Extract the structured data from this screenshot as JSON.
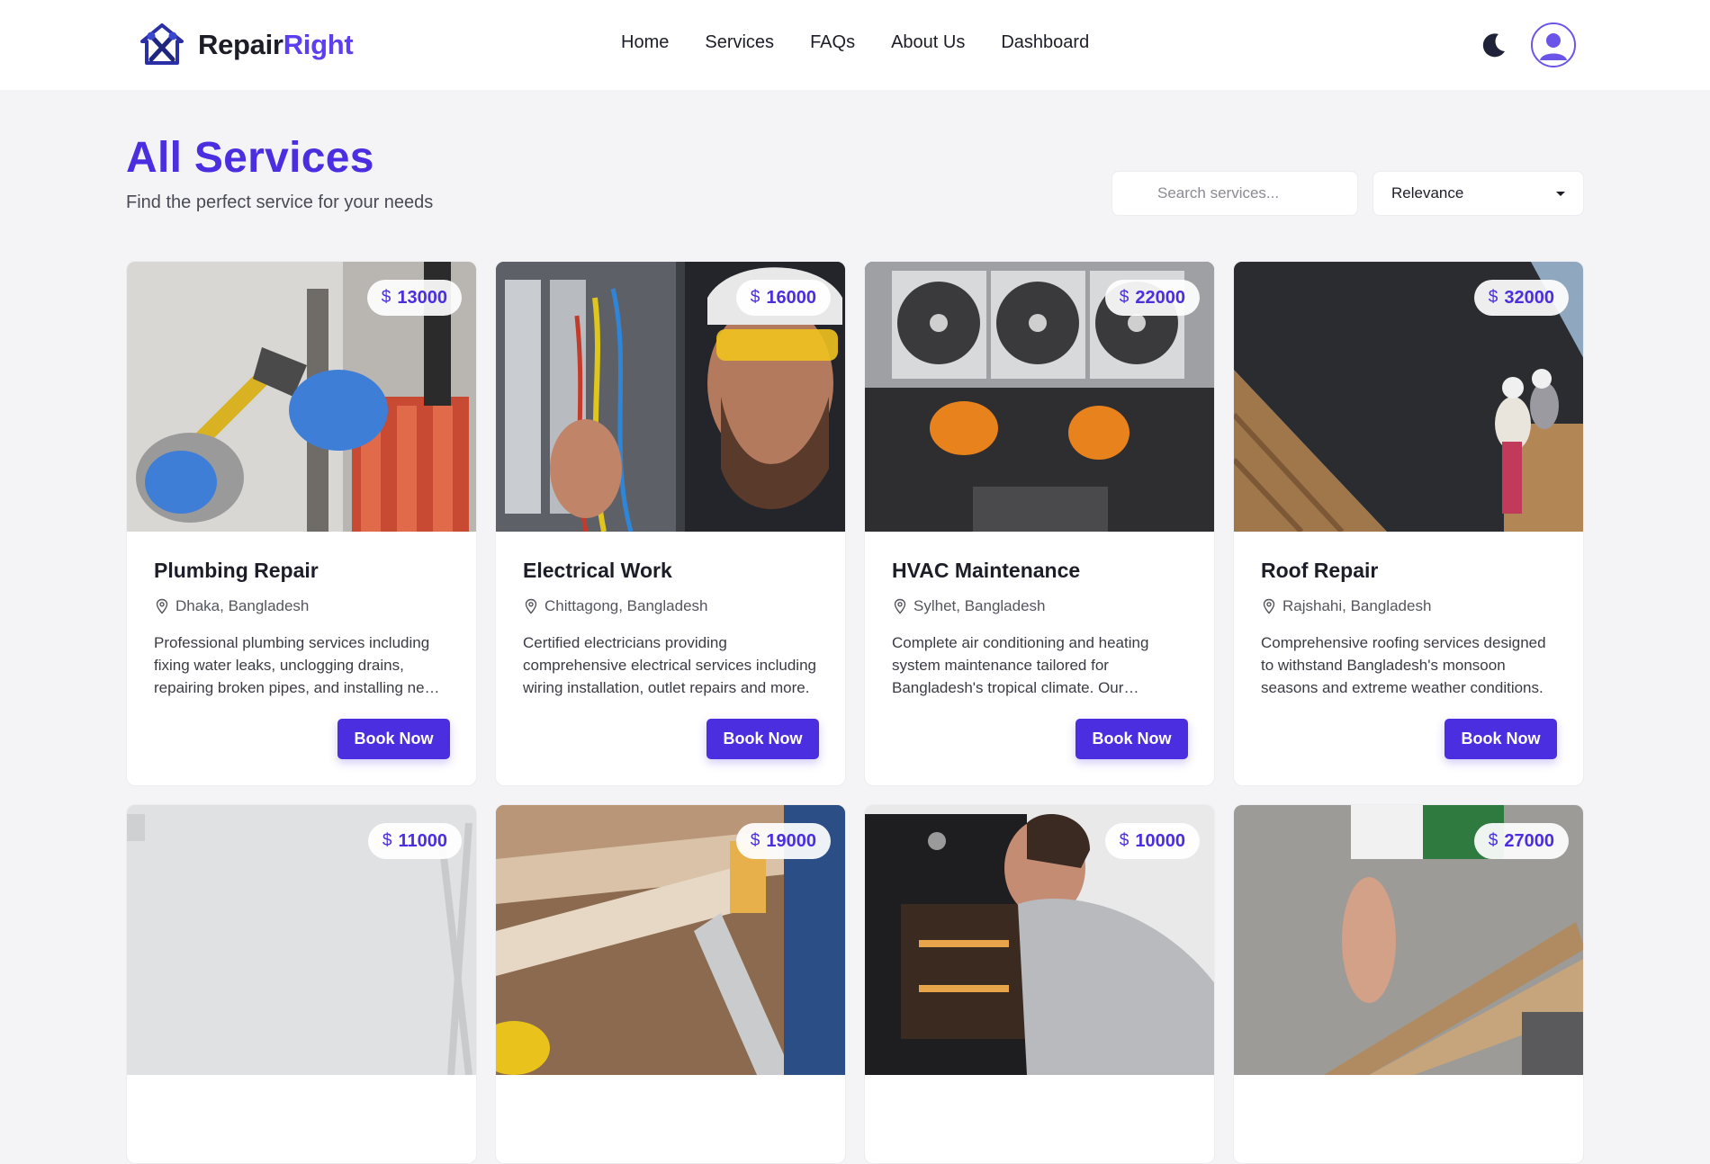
{
  "brand": {
    "name_part1": "Repair",
    "name_part2": "Right",
    "accent": "#5b3ff0"
  },
  "nav": {
    "links": [
      {
        "label": "Home"
      },
      {
        "label": "Services"
      },
      {
        "label": "FAQs"
      },
      {
        "label": "About Us"
      },
      {
        "label": "Dashboard"
      }
    ],
    "theme_icon": "moon-icon",
    "avatar_icon": "user-avatar-icon"
  },
  "hero": {
    "title": "All Services",
    "subtitle": "Find the perfect service for your needs",
    "title_color": "#4a2ee0"
  },
  "filters": {
    "search_placeholder": "Search services...",
    "sort_selected": "Relevance"
  },
  "services": [
    {
      "price": "13000",
      "title": "Plumbing Repair",
      "location": "Dhaka, Bangladesh",
      "description": "Professional plumbing services including fixing water leaks, unclogging drains, repairing broken pipes, and installing new fixtures.",
      "button": "Book Now"
    },
    {
      "price": "16000",
      "title": "Electrical Work",
      "location": "Chittagong, Bangladesh",
      "description": "Certified electricians providing comprehensive electrical services including wiring installation, outlet repairs and more.",
      "button": "Book Now"
    },
    {
      "price": "22000",
      "title": "HVAC Maintenance",
      "location": "Sylhet, Bangladesh",
      "description": "Complete air conditioning and heating system maintenance tailored for Bangladesh's tropical climate. Our technicians ensure efficiency.",
      "button": "Book Now"
    },
    {
      "price": "32000",
      "title": "Roof Repair",
      "location": "Rajshahi, Bangladesh",
      "description": "Comprehensive roofing services designed to withstand Bangladesh's monsoon seasons and extreme weather conditions.",
      "button": "Book Now"
    },
    {
      "price": "11000"
    },
    {
      "price": "19000"
    },
    {
      "price": "10000"
    },
    {
      "price": "27000"
    }
  ],
  "currency_symbol": "$"
}
